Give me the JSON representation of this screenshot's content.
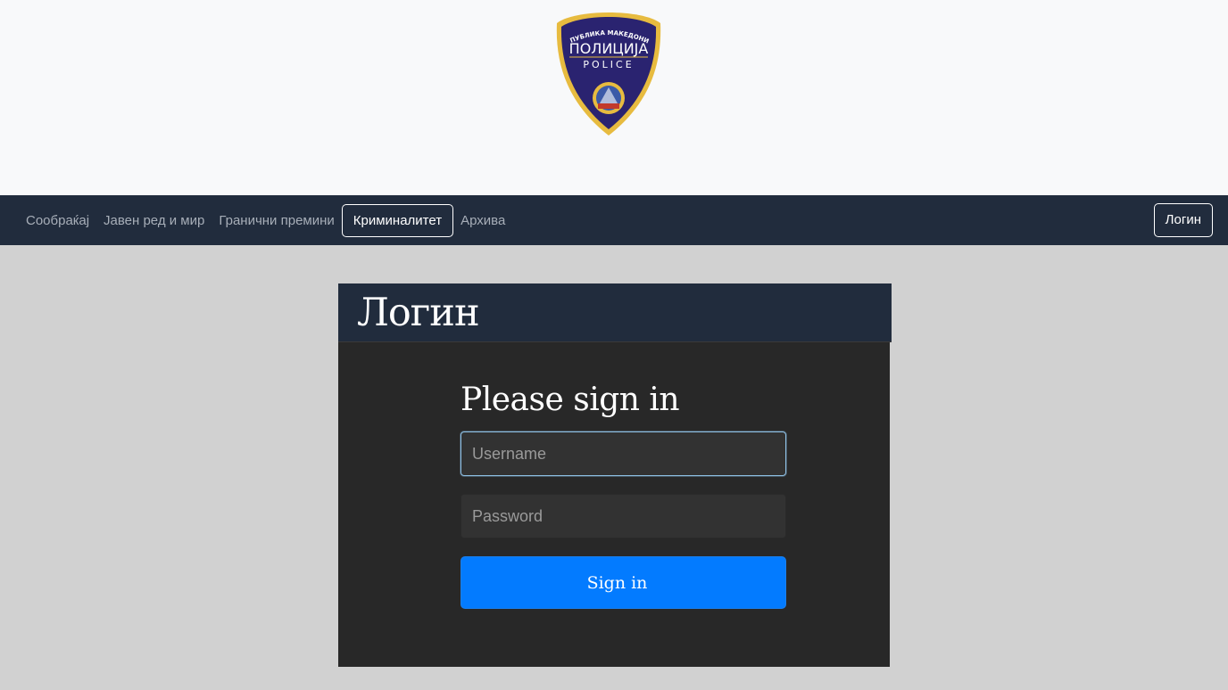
{
  "header": {
    "logo": {
      "text_top": "РЕПУБЛИКА МАКЕДОНИЈА",
      "text_main": "ПОЛИЦИЈА",
      "text_sub": "POLICE"
    }
  },
  "nav": {
    "items": [
      {
        "label": "Сообраќај",
        "active": false
      },
      {
        "label": "Јавен ред и мир",
        "active": false
      },
      {
        "label": "Гранични премини",
        "active": false
      },
      {
        "label": "Криминалитет",
        "active": true
      },
      {
        "label": "Архива",
        "active": false
      }
    ],
    "login_label": "Логин"
  },
  "card": {
    "title": "Логин",
    "form_title": "Please sign in",
    "username_placeholder": "Username",
    "password_placeholder": "Password",
    "submit_label": "Sign in"
  },
  "colors": {
    "navbar": "#212c3d",
    "background": "#d1d1d1",
    "card": "#282828",
    "button": "#037bff"
  }
}
